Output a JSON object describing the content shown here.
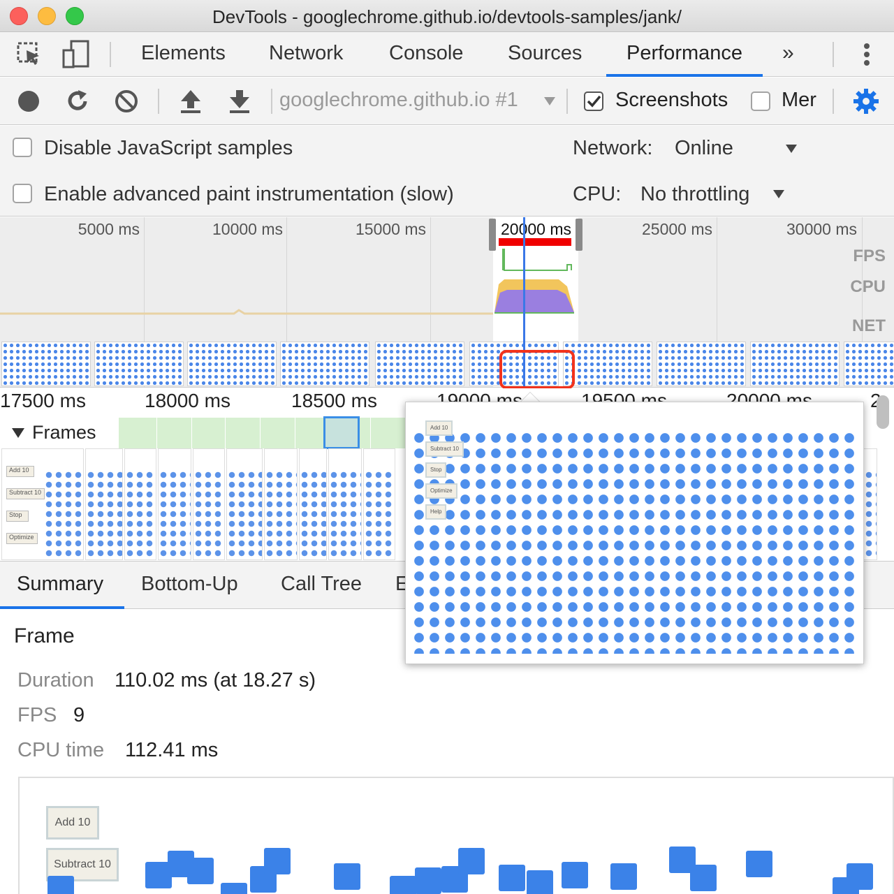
{
  "window": {
    "title": "DevTools - googlechrome.github.io/devtools-samples/jank/"
  },
  "tabs": {
    "items": [
      "Elements",
      "Network",
      "Console",
      "Sources",
      "Performance"
    ],
    "more": "»",
    "active": "Performance"
  },
  "recording_toolbar": {
    "target": "googlechrome.github.io #1",
    "screenshots_label": "Screenshots",
    "screenshots_checked": true,
    "memory_label": "Mer",
    "memory_checked": false
  },
  "settings": {
    "disable_js_samples": "Disable JavaScript samples",
    "advanced_paint": "Enable advanced paint instrumentation (slow)",
    "network_label": "Network:",
    "network_value": "Online",
    "cpu_label": "CPU:",
    "cpu_value": "No throttling"
  },
  "overview": {
    "ticks": [
      "5000 ms",
      "10000 ms",
      "15000 ms",
      "20000 ms",
      "25000 ms",
      "30000 ms"
    ],
    "tracks": [
      "FPS",
      "CPU",
      "NET"
    ]
  },
  "timeline": {
    "ticks": [
      "17500 ms",
      "18000 ms",
      "18500 ms",
      "19000 ms",
      "19500 ms",
      "20000 ms",
      "2"
    ],
    "frames_label": "Frames"
  },
  "screenshot_labels": {
    "add": "Add 10",
    "subtract": "Subtract 10",
    "stop": "Stop",
    "optimize": "Optimize",
    "help": "Help"
  },
  "bottom_tabs": [
    "Summary",
    "Bottom-Up",
    "Call Tree",
    "E"
  ],
  "summary": {
    "title": "Frame",
    "duration_label": "Duration",
    "duration_value": "110.02 ms (at 18.27 s)",
    "fps_label": "FPS",
    "fps_value": "9",
    "cpu_label": "CPU time",
    "cpu_value": "112.41 ms"
  },
  "colors": {
    "accent": "#1a73e8",
    "fps_bar": "#f00000",
    "cpu_scripting": "#f2c55c",
    "cpu_rendering": "#9a7fe0",
    "frame_fill": "#d7f0d1",
    "screenshot_square": "#3b82e8"
  }
}
